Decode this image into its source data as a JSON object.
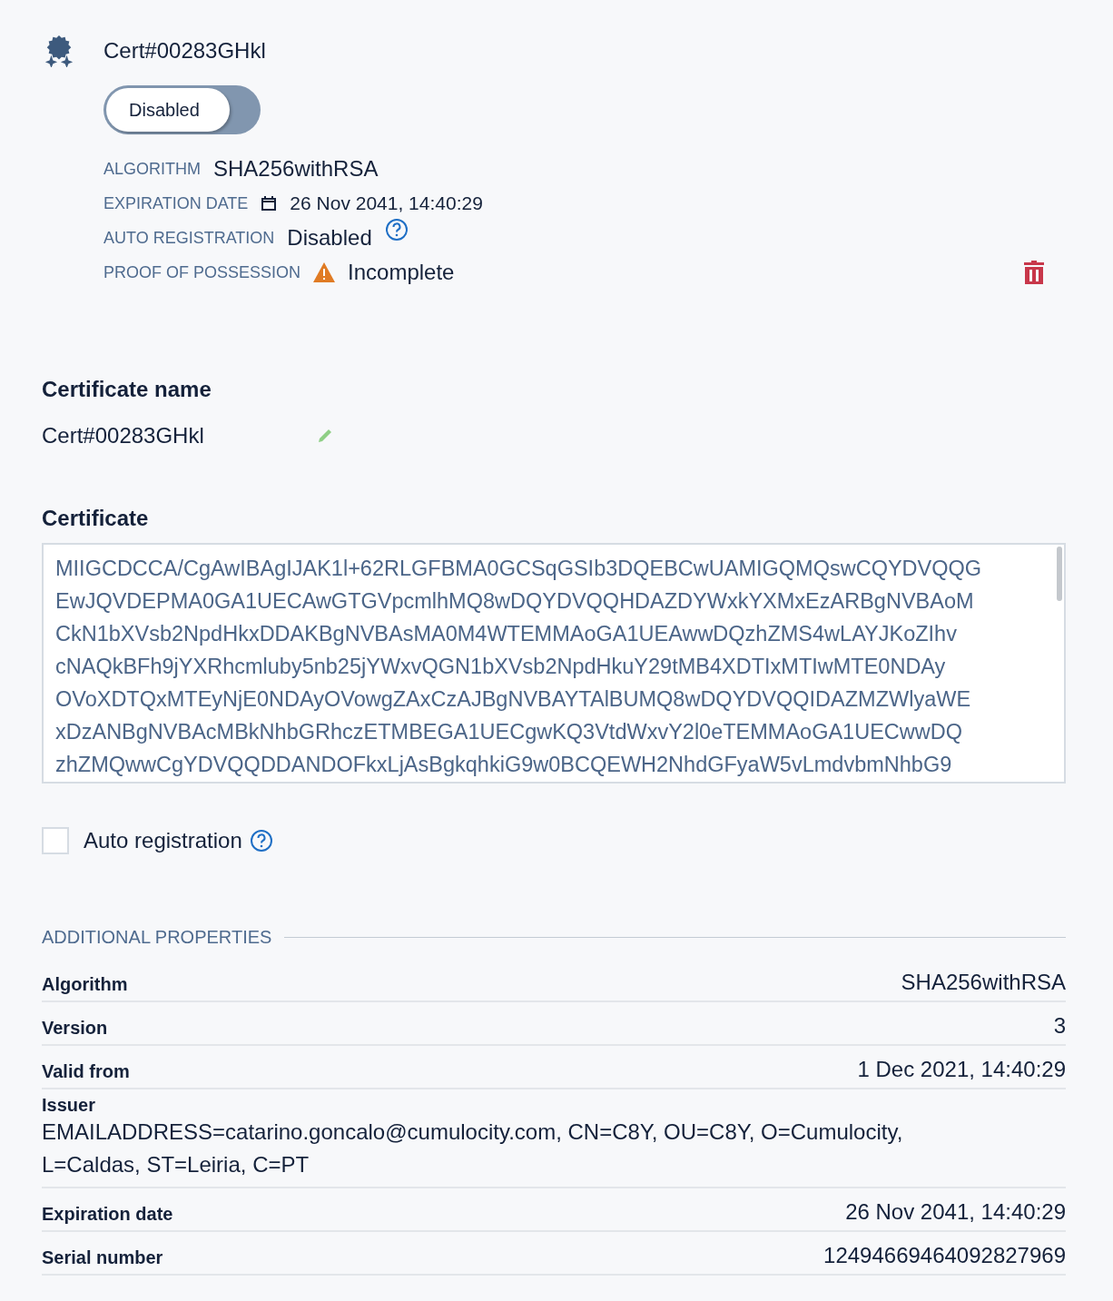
{
  "header": {
    "title": "Cert#00283GHkl",
    "toggle": {
      "label": "Disabled",
      "on": false
    }
  },
  "summary": [
    {
      "kind": "text",
      "label": "ALGORITHM",
      "value": "SHA256withRSA"
    },
    {
      "kind": "date",
      "label": "EXPIRATION DATE",
      "value": "26 Nov 2041, 14:40:29"
    },
    {
      "kind": "help",
      "label": "AUTO REGISTRATION",
      "value": "Disabled"
    },
    {
      "kind": "warning",
      "label": "PROOF OF POSSESSION",
      "value": "Incomplete"
    }
  ],
  "certificate_name": {
    "heading": "Certificate name",
    "value": "Cert#00283GHkl"
  },
  "certificate": {
    "heading": "Certificate",
    "lines": [
      "MIIGCDCCA/CgAwIBAgIJAK1l+62RLGFBMA0GCSqGSIb3DQEBCwUAMIGQMQswCQYDVQQG",
      "EwJQVDEPMA0GA1UECAwGTGVpcmlhMQ8wDQYDVQQHDAZDYWxkYXMxEzARBgNVBAoM",
      "CkN1bXVsb2NpdHkxDDAKBgNVBAsMA0M4WTEMMAoGA1UEAwwDQzhZMS4wLAYJKoZIhv",
      "cNAQkBFh9jYXRhcmluby5nb25jYWxvQGN1bXVsb2NpdHkuY29tMB4XDTIxMTIwMTE0NDAy",
      "OVoXDTQxMTEyNjE0NDAyOVowgZAxCzAJBgNVBAYTAlBUMQ8wDQYDVQQIDAZMZWlyaWE",
      "xDzANBgNVBAcMBkNhbGRhczETMBEGA1UECgwKQ3VtdWxvY2l0eTEMMAoGA1UECwwDQ",
      "zhZMQwwCgYDVQQDDANDOFkxLjAsBgkqhkiG9w0BCQEWH2NhdGFyaW5vLmdvbmNhbG9"
    ]
  },
  "auto_registration": {
    "label": "Auto registration",
    "checked": false
  },
  "additional_properties": {
    "heading": "ADDITIONAL PROPERTIES",
    "rows": [
      {
        "kind": "inline",
        "label": "Algorithm",
        "value": "SHA256withRSA"
      },
      {
        "kind": "inline",
        "label": "Version",
        "value": "3"
      },
      {
        "kind": "inline",
        "label": "Valid from",
        "value": "1 Dec 2021, 14:40:29"
      },
      {
        "kind": "stacked",
        "label": "Issuer",
        "value": "EMAILADDRESS=catarino.goncalo@cumulocity.com, CN=C8Y, OU=C8Y, O=Cumulocity, L=Caldas, ST=Leiria, C=PT"
      },
      {
        "kind": "inline",
        "label": "Expiration date",
        "value": "26 Nov 2041, 14:40:29"
      },
      {
        "kind": "inline",
        "label": "Serial number",
        "value": "12494669464092827969"
      }
    ]
  }
}
